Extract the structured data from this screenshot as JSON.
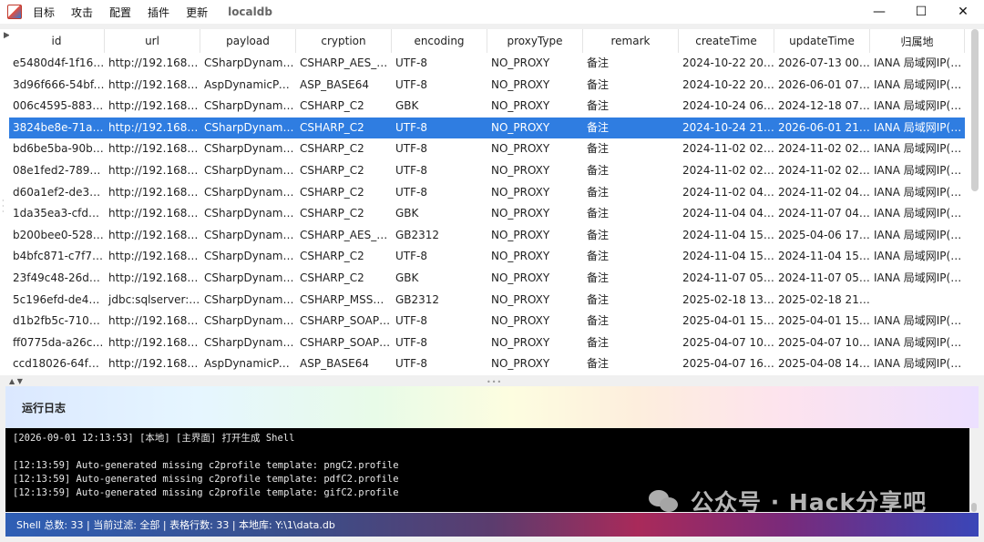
{
  "window": {
    "menu": [
      "目标",
      "攻击",
      "配置",
      "插件",
      "更新"
    ],
    "db_name": "localdb",
    "controls": [
      "—",
      "☐",
      "✕"
    ]
  },
  "table": {
    "columns": [
      "id",
      "url",
      "payload",
      "cryption",
      "encoding",
      "proxyType",
      "remark",
      "createTime",
      "updateTime",
      "归属地"
    ],
    "selected_row": 3,
    "rows": [
      [
        "e5480d4f-1f16-...",
        "http://192.168.1...",
        "CSharpDynamic...",
        "CSHARP_AES_BA...",
        "UTF-8",
        "NO_PROXY",
        "备注",
        "2024-10-22 20:...",
        "2026-07-13 00:...",
        "IANA 局域网IP(Pr..."
      ],
      [
        "3d96f666-54bf-...",
        "http://192.168.1...",
        "AspDynamicPayl...",
        "ASP_BASE64",
        "UTF-8",
        "NO_PROXY",
        "备注",
        "2024-10-22 20:...",
        "2026-06-01 07:...",
        "IANA 局域网IP(Pr..."
      ],
      [
        "006c4595-8838...",
        "http://192.168.1...",
        "CSharpDynamic...",
        "CSHARP_C2",
        "GBK",
        "NO_PROXY",
        "备注",
        "2024-10-24 06:...",
        "2024-12-18 07:...",
        "IANA 局域网IP(Pr..."
      ],
      [
        "3824be8e-71ac-...",
        "http://192.168.1...",
        "CSharpDynamic...",
        "CSHARP_C2",
        "UTF-8",
        "NO_PROXY",
        "备注",
        "2024-10-24 21:...",
        "2026-06-01 21:...",
        "IANA 局域网IP(Pr..."
      ],
      [
        "bd6be5ba-90bf-...",
        "http://192.168.1...",
        "CSharpDynamic...",
        "CSHARP_C2",
        "UTF-8",
        "NO_PROXY",
        "备注",
        "2024-11-02 02:...",
        "2024-11-02 02:...",
        "IANA 局域网IP(Pr..."
      ],
      [
        "08e1fed2-789e-...",
        "http://192.168.1...",
        "CSharpDynamic...",
        "CSHARP_C2",
        "UTF-8",
        "NO_PROXY",
        "备注",
        "2024-11-02 02:...",
        "2024-11-02 02:...",
        "IANA 局域网IP(Pr..."
      ],
      [
        "d60a1ef2-de35-...",
        "http://192.168.1...",
        "CSharpDynamic...",
        "CSHARP_C2",
        "UTF-8",
        "NO_PROXY",
        "备注",
        "2024-11-02 04:...",
        "2024-11-02 04:...",
        "IANA 局域网IP(Pr..."
      ],
      [
        "1da35ea3-cfdb-...",
        "http://192.168.1...",
        "CSharpDynamic...",
        "CSHARP_C2",
        "GBK",
        "NO_PROXY",
        "备注",
        "2024-11-04 04:...",
        "2024-11-07 04:...",
        "IANA 局域网IP(Pr..."
      ],
      [
        "b200bee0-5289...",
        "http://192.168.1...",
        "CSharpDynamic...",
        "CSHARP_AES_BA...",
        "GB2312",
        "NO_PROXY",
        "备注",
        "2024-11-04 15:...",
        "2025-04-06 17:...",
        "IANA 局域网IP(Pr..."
      ],
      [
        "b4bfc871-c7f7-...",
        "http://192.168.1...",
        "CSharpDynamic...",
        "CSHARP_C2",
        "UTF-8",
        "NO_PROXY",
        "备注",
        "2024-11-04 15:...",
        "2024-11-04 15:...",
        "IANA 局域网IP(Pr..."
      ],
      [
        "23f49c48-26dd-...",
        "http://192.168.1...",
        "CSharpDynamic...",
        "CSHARP_C2",
        "GBK",
        "NO_PROXY",
        "备注",
        "2024-11-07 05:...",
        "2024-11-07 05:...",
        "IANA 局域网IP(Pr..."
      ],
      [
        "5c196efd-de44-...",
        "jdbc:sqlserver://...",
        "CSharpDynamic...",
        "CSHARP_MSSQL...",
        "GB2312",
        "NO_PROXY",
        "备注",
        "2025-02-18 13:...",
        "2025-02-18 21:...",
        ""
      ],
      [
        "d1b2fb5c-710d-...",
        "http://192.168.1...",
        "CSharpDynamic...",
        "CSHARP_SOAP_...",
        "UTF-8",
        "NO_PROXY",
        "备注",
        "2025-04-01 15:...",
        "2025-04-01 15:...",
        "IANA 局域网IP(Pr..."
      ],
      [
        "ff0775da-a26c-...",
        "http://192.168.1...",
        "CSharpDynamic...",
        "CSHARP_SOAP_...",
        "UTF-8",
        "NO_PROXY",
        "备注",
        "2025-04-07 10:...",
        "2025-04-07 10:...",
        "IANA 局域网IP(Pr..."
      ],
      [
        "ccd18026-64f9-...",
        "http://192.168.1...",
        "AspDynamicPayl...",
        "ASP_BASE64",
        "UTF-8",
        "NO_PROXY",
        "备注",
        "2025-04-07 16:...",
        "2025-04-08 14:...",
        "IANA 局域网IP(Pr..."
      ]
    ]
  },
  "log": {
    "title": "运行日志",
    "lines": [
      "[2026-09-01 12:13:53] [本地] [主界面] 打开生成 Shell",
      "",
      "[12:13:59] Auto-generated missing c2profile template: pngC2.profile",
      "[12:13:59] Auto-generated missing c2profile template: pdfC2.profile",
      "[12:13:59] Auto-generated missing c2profile template: gifC2.profile"
    ]
  },
  "watermark": "公众号 · Hack分享吧",
  "status": "Shell 总数: 33 | 当前过滤: 全部 | 表格行数: 33 | 本地库: Y:\\1\\data.db",
  "colors": {
    "selected_row": "#2f7de1",
    "log_background": "#000000"
  }
}
